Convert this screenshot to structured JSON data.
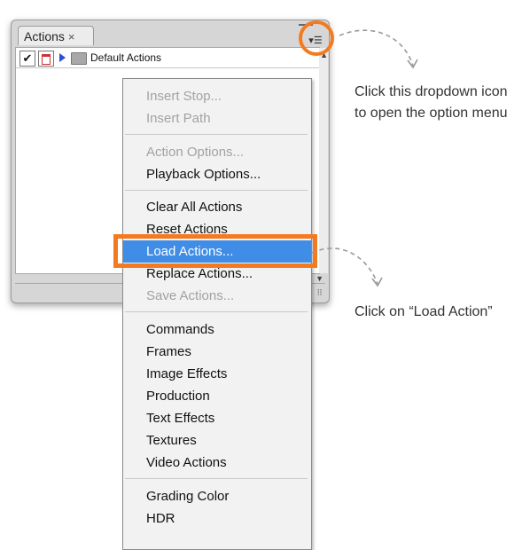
{
  "panel": {
    "tab_label": "Actions",
    "tab_close": "×",
    "menu_button_glyph": "▾☰",
    "check_glyph": "✔",
    "action_set": "Default Actions",
    "scroll_up": "▲",
    "scroll_down": "▼",
    "grip": "⠿"
  },
  "menu": {
    "items": [
      {
        "label": "Insert Stop...",
        "disabled": true
      },
      {
        "label": "Insert Path",
        "disabled": true
      },
      {
        "label": "Action Options...",
        "disabled": true
      },
      {
        "label": "Playback Options...",
        "disabled": false
      },
      {
        "label": "Clear All Actions",
        "disabled": false
      },
      {
        "label": "Reset Actions",
        "disabled": false
      },
      {
        "label": "Load Actions...",
        "disabled": false,
        "selected": true
      },
      {
        "label": "Replace Actions...",
        "disabled": false
      },
      {
        "label": "Save Actions...",
        "disabled": true
      },
      {
        "label": "Commands",
        "disabled": false
      },
      {
        "label": "Frames",
        "disabled": false
      },
      {
        "label": "Image Effects",
        "disabled": false
      },
      {
        "label": "Production",
        "disabled": false
      },
      {
        "label": "Text Effects",
        "disabled": false
      },
      {
        "label": "Textures",
        "disabled": false
      },
      {
        "label": "Video Actions",
        "disabled": false
      },
      {
        "label": "Grading Color",
        "disabled": false
      },
      {
        "label": "HDR",
        "disabled": false
      }
    ]
  },
  "callouts": {
    "dropdown_line1": "Click this dropdown icon",
    "dropdown_line2": "to open the option menu",
    "load": "Click on “Load Action”"
  },
  "colors": {
    "highlight_orange": "#f47a20",
    "selection_blue": "#3f8de6"
  }
}
